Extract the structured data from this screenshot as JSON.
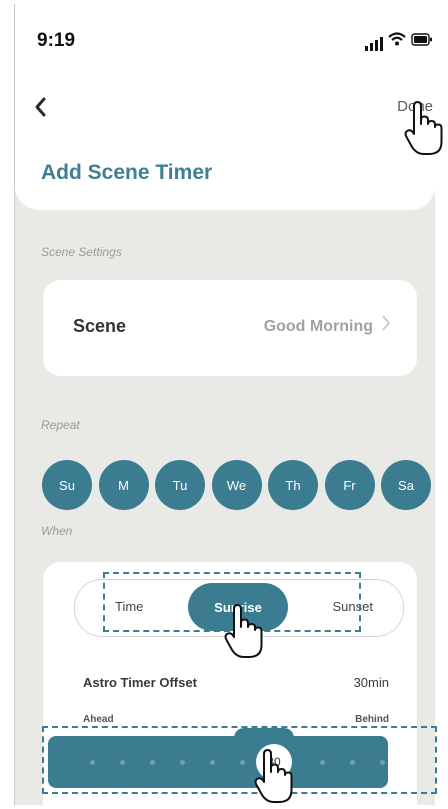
{
  "status": {
    "time": "9:19"
  },
  "header": {
    "done_label": "Done",
    "title": "Add Scene Timer"
  },
  "scene_settings": {
    "section_label": "Scene Settings",
    "scene_label": "Scene",
    "scene_value": "Good Morning"
  },
  "repeat": {
    "section_label": "Repeat",
    "days": [
      "Su",
      "M",
      "Tu",
      "We",
      "Th",
      "Fr",
      "Sa"
    ]
  },
  "when": {
    "section_label": "When",
    "segments": {
      "time": "Time",
      "sunrise": "Sunrise",
      "sunset": "Sunset",
      "selected": "Sunrise"
    },
    "offset_label": "Astro Timer Offset",
    "offset_value": "30min",
    "ahead_label": "Ahead",
    "behind_label": "Behind",
    "slider_value": "30"
  },
  "colors": {
    "accent": "#3c7c91",
    "background": "#e9e9e5",
    "card": "#ffffff"
  },
  "icons": [
    "back-chevron-icon",
    "signal-icon",
    "wifi-icon",
    "battery-icon",
    "pointer-hand-icon"
  ]
}
